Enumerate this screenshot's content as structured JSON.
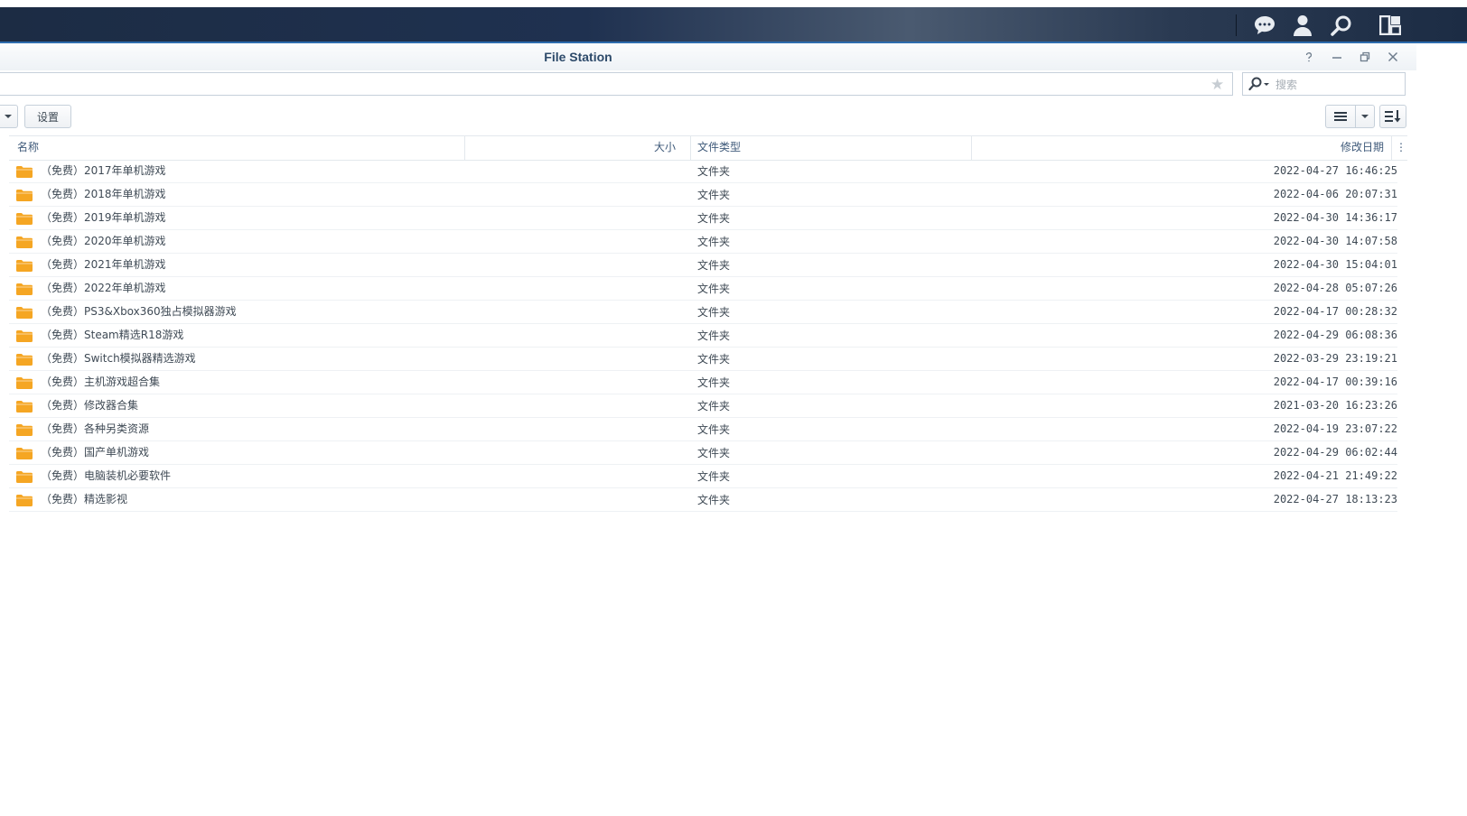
{
  "window": {
    "title": "File Station"
  },
  "topbar_icons": [
    "chat-icon",
    "user-icon",
    "search-icon",
    "widgets-icon"
  ],
  "toolbar": {
    "settings_label": "设置"
  },
  "search": {
    "placeholder": "搜索"
  },
  "table": {
    "columns": {
      "name": "名称",
      "size": "大小",
      "type": "文件类型",
      "modified": "修改日期"
    },
    "rows": [
      {
        "name": "（免费）2017年单机游戏",
        "type": "文件夹",
        "modified": "2022-04-27 16:46:25"
      },
      {
        "name": "（免费）2018年单机游戏",
        "type": "文件夹",
        "modified": "2022-04-06 20:07:31"
      },
      {
        "name": "（免费）2019年单机游戏",
        "type": "文件夹",
        "modified": "2022-04-30 14:36:17"
      },
      {
        "name": "（免费）2020年单机游戏",
        "type": "文件夹",
        "modified": "2022-04-30 14:07:58"
      },
      {
        "name": "（免费）2021年单机游戏",
        "type": "文件夹",
        "modified": "2022-04-30 15:04:01"
      },
      {
        "name": "（免费）2022年单机游戏",
        "type": "文件夹",
        "modified": "2022-04-28 05:07:26"
      },
      {
        "name": "（免费）PS3&Xbox360独占模拟器游戏",
        "type": "文件夹",
        "modified": "2022-04-17 00:28:32"
      },
      {
        "name": "（免费）Steam精选R18游戏",
        "type": "文件夹",
        "modified": "2022-04-29 06:08:36"
      },
      {
        "name": "（免费）Switch模拟器精选游戏",
        "type": "文件夹",
        "modified": "2022-03-29 23:19:21"
      },
      {
        "name": "（免费）主机游戏超合集",
        "type": "文件夹",
        "modified": "2022-04-17 00:39:16"
      },
      {
        "name": "（免费）修改器合集",
        "type": "文件夹",
        "modified": "2021-03-20 16:23:26"
      },
      {
        "name": "（免费）各种另类资源",
        "type": "文件夹",
        "modified": "2022-04-19 23:07:22"
      },
      {
        "name": "（免费）国产单机游戏",
        "type": "文件夹",
        "modified": "2022-04-29 06:02:44"
      },
      {
        "name": "（免费）电脑装机必要软件",
        "type": "文件夹",
        "modified": "2022-04-21 21:49:22"
      },
      {
        "name": "（免费）精选影视",
        "type": "文件夹",
        "modified": "2022-04-27 18:13:23"
      }
    ]
  },
  "colors": {
    "folder": "#f5a623",
    "header_text": "#3f5a7a",
    "title_text": "#2d4a6a"
  }
}
